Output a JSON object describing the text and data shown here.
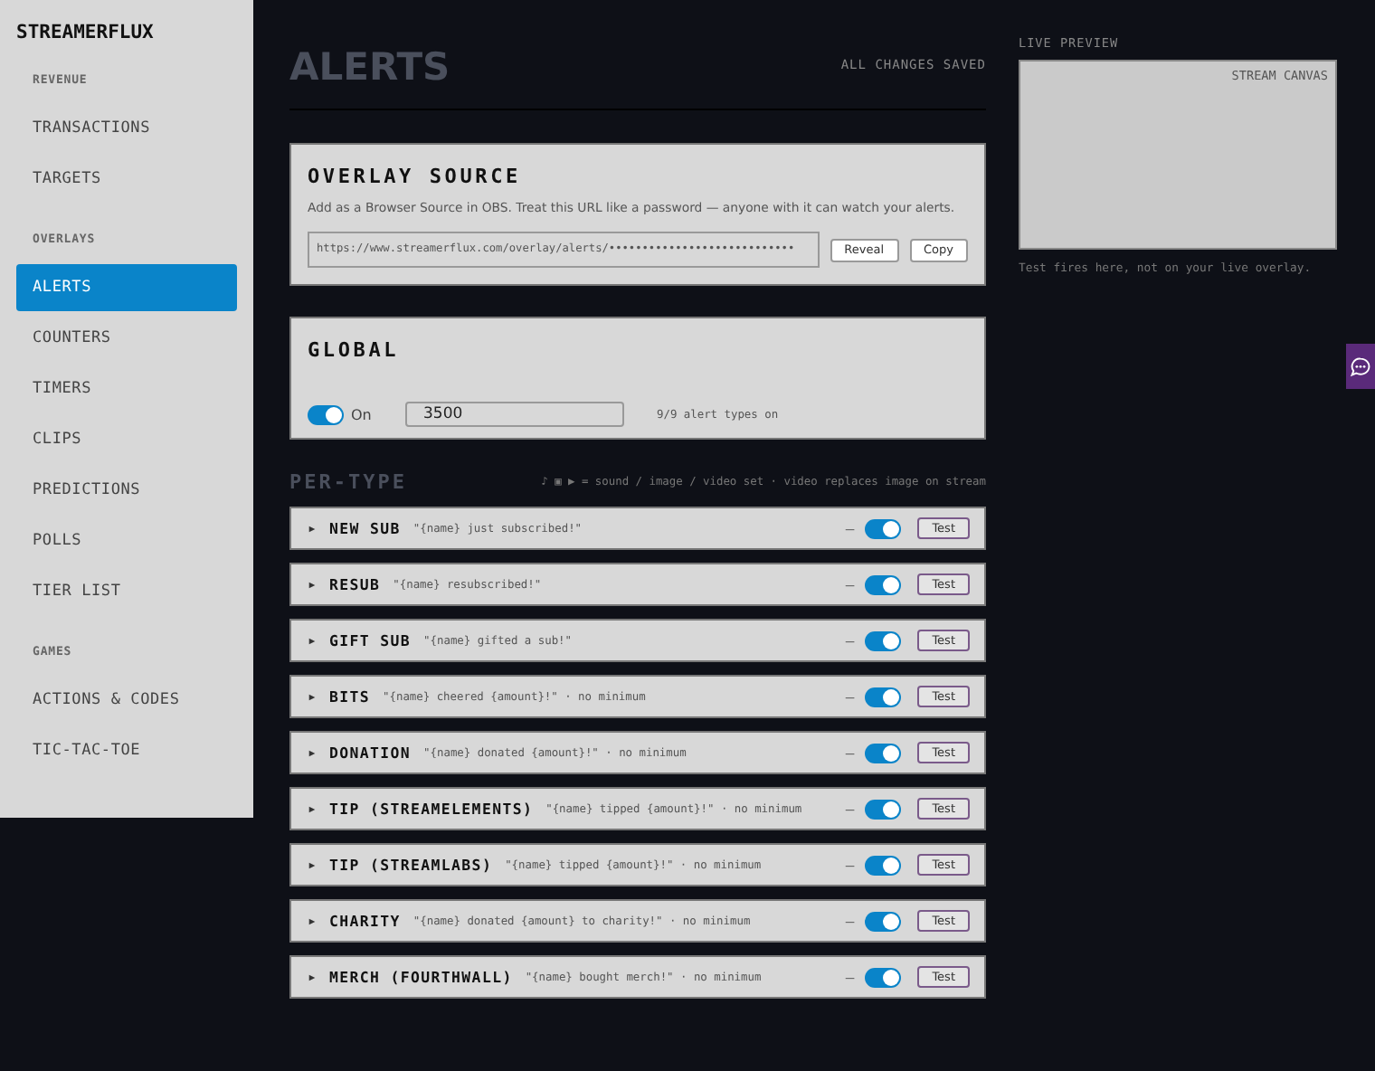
{
  "sidebar": {
    "brand": "STREAMERFLUX",
    "sections": [
      {
        "heading": "REVENUE",
        "items": [
          {
            "label": "TRANSACTIONS",
            "selected": false
          },
          {
            "label": "TARGETS",
            "selected": false
          }
        ]
      },
      {
        "heading": "OVERLAYS",
        "items": [
          {
            "label": "ALERTS",
            "selected": true
          },
          {
            "label": "COUNTERS",
            "selected": false
          },
          {
            "label": "TIMERS",
            "selected": false
          },
          {
            "label": "CLIPS",
            "selected": false
          },
          {
            "label": "PREDICTIONS",
            "selected": false
          },
          {
            "label": "POLLS",
            "selected": false
          },
          {
            "label": "TIER LIST",
            "selected": false
          }
        ]
      },
      {
        "heading": "GAMES",
        "items": [
          {
            "label": "ACTIONS & CODES",
            "selected": false
          },
          {
            "label": "TIC-TAC-TOE",
            "selected": false
          }
        ]
      }
    ]
  },
  "header": {
    "title": "ALERTS",
    "status": "ALL CHANGES SAVED"
  },
  "overlay_source": {
    "title": "OVERLAY SOURCE",
    "description": "Add as a Browser Source in OBS. Treat this URL like a password — anyone with it can watch your alerts.",
    "url": "https://www.streamerflux.com/overlay/alerts/••••••••••••••••••••••••••••",
    "buttons": [
      "Reveal",
      "Copy"
    ]
  },
  "global": {
    "title": "GLOBAL",
    "on": true,
    "toggle_label": "On",
    "duration": "3500",
    "summary": "9/9 alert types on"
  },
  "per_type": {
    "title": "PER-TYPE",
    "legend": "♪ ▣ ▶ = sound / image / video set · video replaces image on stream",
    "alerts": [
      {
        "name": "NEW SUB",
        "message": "\"{name} just subscribed!\"",
        "media": "–",
        "on": true,
        "test": "Test"
      },
      {
        "name": "RESUB",
        "message": "\"{name} resubscribed!\"",
        "media": "–",
        "on": true,
        "test": "Test"
      },
      {
        "name": "GIFT SUB",
        "message": "\"{name} gifted a sub!\"",
        "media": "–",
        "on": true,
        "test": "Test"
      },
      {
        "name": "BITS",
        "message": "\"{name} cheered {amount}!\" · no minimum",
        "media": "–",
        "on": true,
        "test": "Test"
      },
      {
        "name": "DONATION",
        "message": "\"{name} donated {amount}!\" · no minimum",
        "media": "–",
        "on": true,
        "test": "Test"
      },
      {
        "name": "TIP (STREAMELEMENTS)",
        "message": "\"{name} tipped {amount}!\" · no minimum",
        "media": "–",
        "on": true,
        "test": "Test"
      },
      {
        "name": "TIP (STREAMLABS)",
        "message": "\"{name} tipped {amount}!\" · no minimum",
        "media": "–",
        "on": true,
        "test": "Test"
      },
      {
        "name": "CHARITY",
        "message": "\"{name} donated {amount} to charity!\" · no minimum",
        "media": "–",
        "on": true,
        "test": "Test"
      },
      {
        "name": "MERCH (FOURTHWALL)",
        "message": "\"{name} bought merch!\" · no minimum",
        "media": "–",
        "on": true,
        "test": "Test"
      }
    ]
  },
  "preview": {
    "label": "LIVE PREVIEW",
    "canvas_label": "STREAM CANVAS",
    "caption": "Test fires here, not on your live overlay."
  }
}
